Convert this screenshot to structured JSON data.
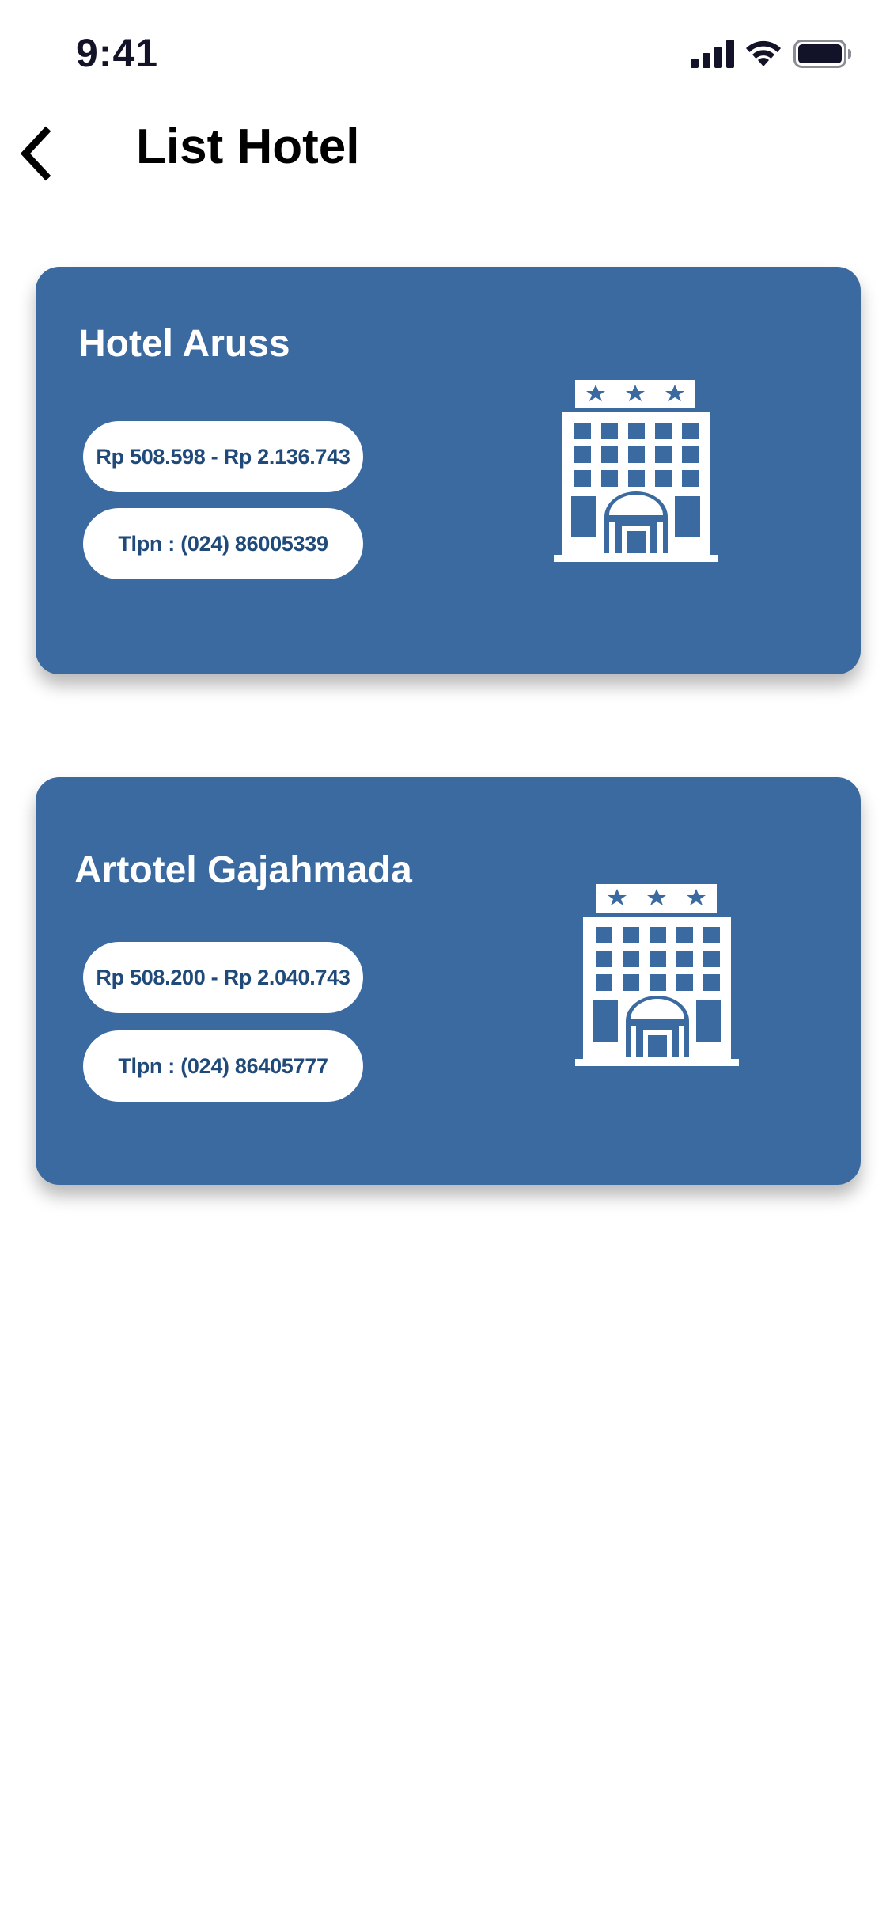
{
  "status_bar": {
    "time": "9:41"
  },
  "header": {
    "title": "List Hotel"
  },
  "hotels": [
    {
      "name": "Hotel Aruss",
      "price_range": "Rp 508.598 - Rp 2.136.743",
      "phone": "Tlpn : (024) 86005339"
    },
    {
      "name": "Artotel Gajahmada",
      "price_range": "Rp 508.200 - Rp 2.040.743",
      "phone": "Tlpn : (024) 86405777"
    }
  ],
  "icons": {
    "back": "chevron-left-icon",
    "hotel": "hotel-building-icon",
    "signal": "cellular-signal-icon",
    "wifi": "wifi-icon",
    "battery": "battery-icon"
  },
  "colors": {
    "card_background": "#3b6aa0",
    "pill_text": "#1f4a7a",
    "card_text": "#ffffff",
    "status_text": "#121229"
  }
}
